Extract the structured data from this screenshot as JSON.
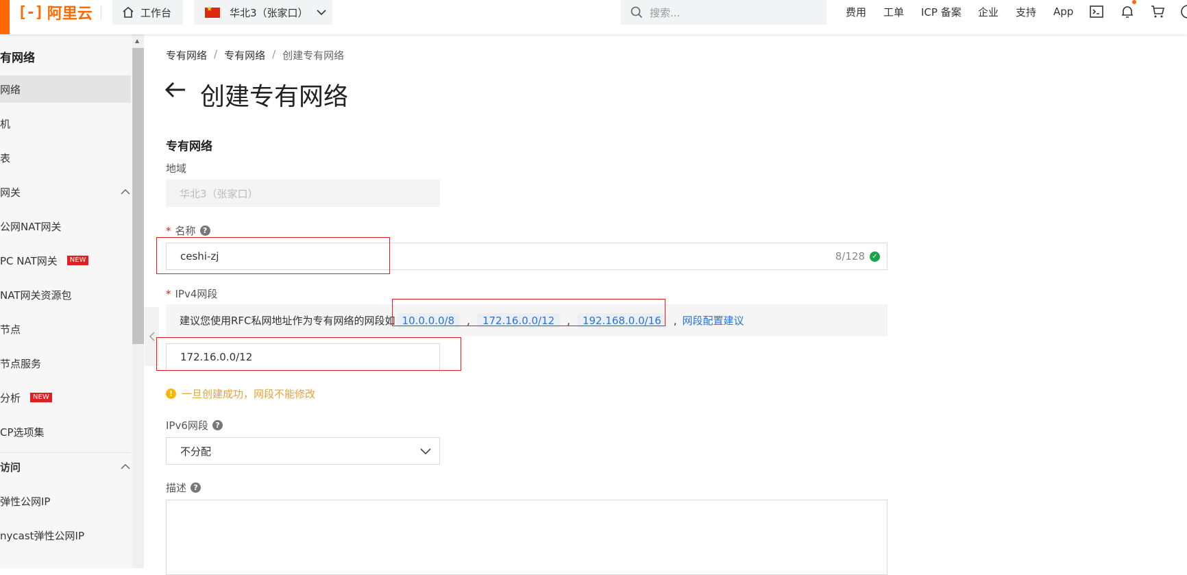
{
  "topbar": {
    "logo_mark": "[-]",
    "logo_text": "阿里云",
    "workbench": "工作台",
    "region": "华北3（张家口）",
    "search_placeholder": "搜索...",
    "nav": [
      "费用",
      "工单",
      "ICP 备案",
      "企业",
      "支持",
      "App"
    ],
    "icons": [
      "terminal-icon",
      "bell-icon",
      "cart-icon",
      "help-icon"
    ]
  },
  "sidebar": {
    "title": "有网络",
    "items": [
      {
        "label": "网络",
        "active": true
      },
      {
        "label": "机"
      },
      {
        "label": "表"
      },
      {
        "label": "网关",
        "group": true
      },
      {
        "label": "公网NAT网关"
      },
      {
        "label": "PC NAT网关",
        "badge": "NEW"
      },
      {
        "label": "NAT网关资源包"
      },
      {
        "label": "节点"
      },
      {
        "label": "节点服务"
      },
      {
        "label": "分析",
        "badge": "NEW"
      },
      {
        "label": "CP选项集"
      },
      {
        "label": "访问",
        "group": true
      },
      {
        "label": "弹性公网IP"
      },
      {
        "label": "nycast弹性公网IP"
      }
    ]
  },
  "breadcrumb": [
    "专有网络",
    "专有网络",
    "创建专有网络"
  ],
  "page_title": "创建专有网络",
  "section_title": "专有网络",
  "form": {
    "region_label": "地域",
    "region_value": "华北3（张家口）",
    "name_label": "名称",
    "name_value": "ceshi-zj",
    "name_counter": "8/128",
    "ipv4_label": "IPv4网段",
    "ipv4_hint_prefix": "建议您使用RFC私网地址作为专有网络的网段如",
    "ipv4_suggestions": [
      "10.0.0.0/8",
      "172.16.0.0/12",
      "192.168.0.0/16"
    ],
    "ipv4_hint_link": "网段配置建议",
    "ipv4_value": "172.16.0.0/12",
    "ipv4_warning": "一旦创建成功，网段不能修改",
    "ipv6_label": "IPv6网段",
    "ipv6_value": "不分配",
    "desc_label": "描述"
  },
  "colors": {
    "brand": "#ff6a00",
    "link": "#2a72d5",
    "highlight": "#e8191f",
    "warning": "#e6a23c"
  }
}
